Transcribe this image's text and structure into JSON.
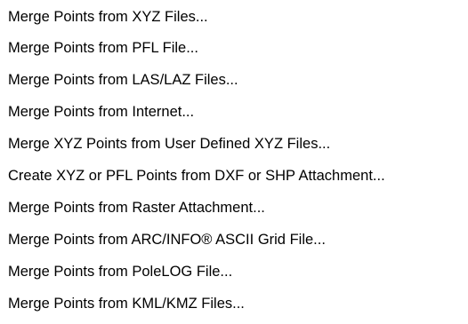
{
  "menu": {
    "items": [
      {
        "label": "Merge Points from XYZ Files..."
      },
      {
        "label": "Merge Points from PFL File..."
      },
      {
        "label": "Merge Points from LAS/LAZ Files..."
      },
      {
        "label": "Merge Points from Internet..."
      },
      {
        "label": "Merge XYZ Points from User Defined XYZ Files..."
      },
      {
        "label": "Create XYZ or PFL Points from DXF or SHP Attachment..."
      },
      {
        "label": "Merge Points from Raster Attachment..."
      },
      {
        "label": "Merge Points from ARC/INFO® ASCII Grid File..."
      },
      {
        "label": "Merge Points from PoleLOG File..."
      },
      {
        "label": "Merge Points from KML/KMZ Files..."
      }
    ]
  }
}
